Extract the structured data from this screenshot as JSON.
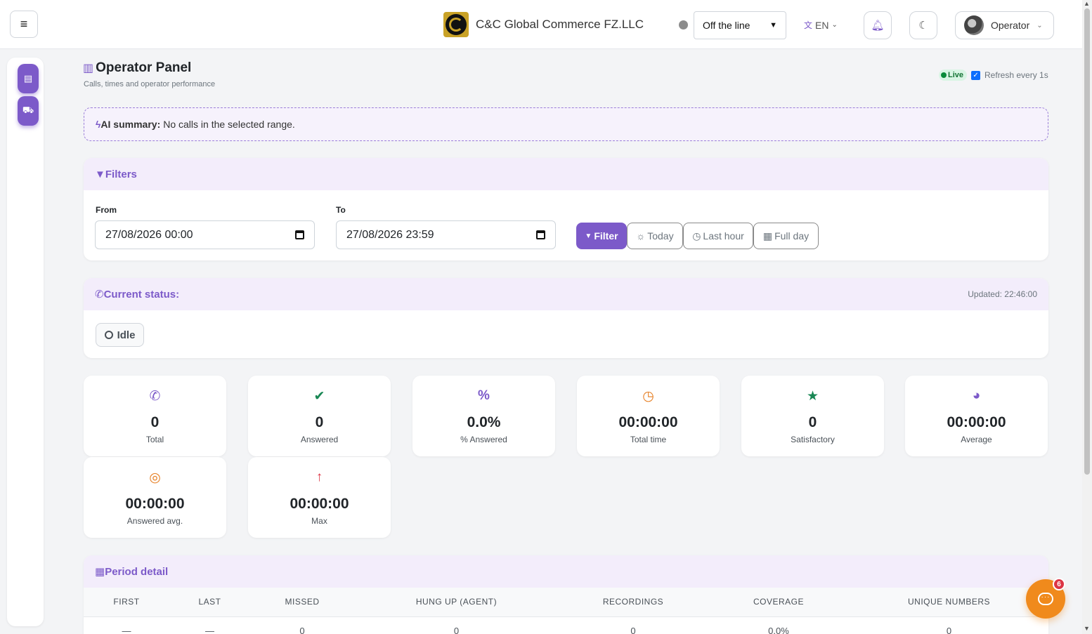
{
  "header": {
    "menu_icon": "hamburger-icon",
    "company": "C&C Global Commerce FZ.LLC",
    "status_select": "Off the line",
    "language": "EN",
    "user": "Operator"
  },
  "page": {
    "title": "Operator Panel",
    "subtitle": "Calls, times and operator performance",
    "live_label": "Live",
    "refresh_label": "Refresh every 1s"
  },
  "ai_summary": {
    "label": "AI summary:",
    "text": "No calls in the selected range."
  },
  "filters": {
    "title": "Filters",
    "from_label": "From",
    "from_value": "27/08/2026 00:00",
    "to_label": "To",
    "to_value": "27/08/2026 23:59",
    "filter_btn": "Filter",
    "today_btn": "Today",
    "last_hour_btn": "Last hour",
    "full_day_btn": "Full day"
  },
  "current_status": {
    "title": "Current status:",
    "updated": "Updated: 22:46:00",
    "state": "Idle"
  },
  "stats": [
    {
      "value": "0",
      "label": "Total",
      "icon": "phone-icon",
      "color": "#7c5ac9"
    },
    {
      "value": "0",
      "label": "Answered",
      "icon": "check-circle-icon",
      "color": "#198754"
    },
    {
      "value": "0.0%",
      "label": "% Answered",
      "icon": "percent-icon",
      "color": "#7c5ac9"
    },
    {
      "value": "00:00:00",
      "label": "Total time",
      "icon": "clock-icon",
      "color": "#e67e22"
    },
    {
      "value": "0",
      "label": "Satisfactory",
      "icon": "star-icon",
      "color": "#198754"
    },
    {
      "value": "00:00:00",
      "label": "Average",
      "icon": "gauge-icon",
      "color": "#7c5ac9"
    },
    {
      "value": "00:00:00",
      "label": "Answered avg.",
      "icon": "target-icon",
      "color": "#e67e22"
    },
    {
      "value": "00:00:00",
      "label": "Max",
      "icon": "arrow-up-icon",
      "color": "#dc3545"
    }
  ],
  "period": {
    "title": "Period detail",
    "columns": [
      "First",
      "Last",
      "Missed",
      "Hung up (agent)",
      "Recordings",
      "Coverage",
      "Unique numbers"
    ],
    "row": [
      "—",
      "—",
      "0",
      "0",
      "0",
      "0.0%",
      "0"
    ]
  },
  "chat": {
    "badge": "6"
  }
}
